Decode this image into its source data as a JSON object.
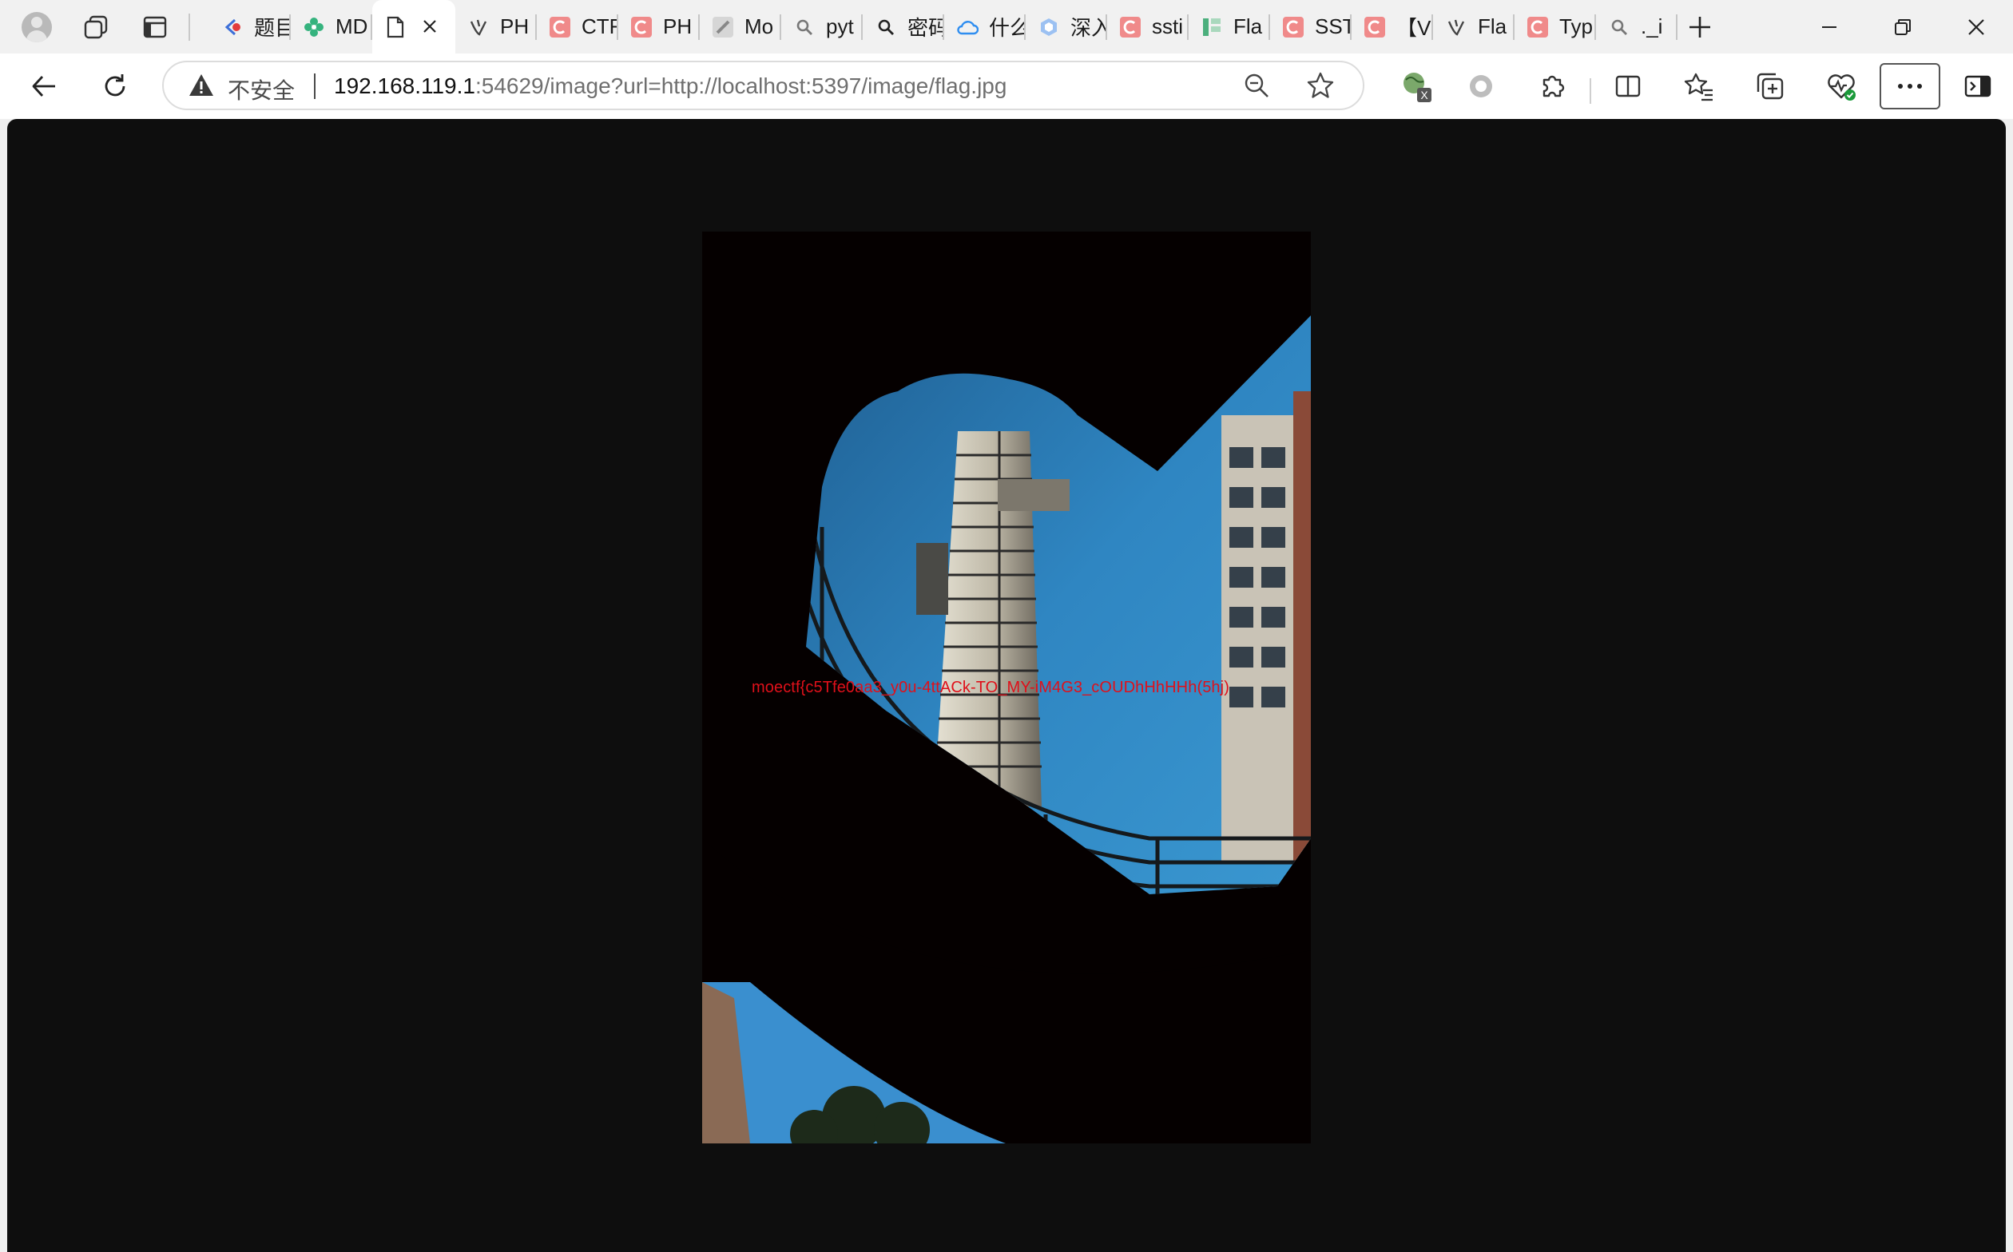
{
  "browser": {
    "tabs": [
      {
        "name": "tab-1",
        "title": "题目",
        "icon": "red-arrow-favicon",
        "color": "#e23b3b"
      },
      {
        "name": "tab-2",
        "title": "MD",
        "icon": "flower-favicon",
        "color": "#35b37e"
      },
      {
        "name": "tab-3",
        "title": "",
        "icon": "page-icon",
        "color": "#555555",
        "active": true
      },
      {
        "name": "tab-4",
        "title": "PH",
        "icon": "bird-favicon",
        "color": "#555555"
      },
      {
        "name": "tab-5",
        "title": "CTF",
        "icon": "c-favicon",
        "color": "#f08a8a"
      },
      {
        "name": "tab-6",
        "title": "PH",
        "icon": "c-favicon",
        "color": "#f08a8a"
      },
      {
        "name": "tab-7",
        "title": "Mo",
        "icon": "pen-favicon",
        "color": "#aaaaaa"
      },
      {
        "name": "tab-8",
        "title": "pyt",
        "icon": "search-favicon",
        "color": "#777777"
      },
      {
        "name": "tab-9",
        "title": "密码",
        "icon": "search-favicon",
        "color": "#222222"
      },
      {
        "name": "tab-10",
        "title": "什么",
        "icon": "cloud-favicon",
        "color": "#2f8ef0"
      },
      {
        "name": "tab-11",
        "title": "深入",
        "icon": "hex-favicon",
        "color": "#7aa6e6"
      },
      {
        "name": "tab-12",
        "title": "ssti",
        "icon": "c-favicon",
        "color": "#f08a8a"
      },
      {
        "name": "tab-13",
        "title": "Fla",
        "icon": "bars-favicon",
        "color": "#4caf7d"
      },
      {
        "name": "tab-14",
        "title": "SST",
        "icon": "c-favicon",
        "color": "#f08a8a"
      },
      {
        "name": "tab-15",
        "title": "【V",
        "icon": "c-favicon",
        "color": "#f08a8a"
      },
      {
        "name": "tab-16",
        "title": "Fla",
        "icon": "bird-favicon",
        "color": "#555555"
      },
      {
        "name": "tab-17",
        "title": "Typ",
        "icon": "c-favicon",
        "color": "#f08a8a"
      },
      {
        "name": "tab-18",
        "title": "._i",
        "icon": "search-favicon",
        "color": "#777777"
      }
    ],
    "address_bar": {
      "security_label": "不安全",
      "url_host": "192.168.119.1",
      "url_rest": ":54629/image?url=http://localhost:5397/image/flag.jpg"
    }
  },
  "page": {
    "image_overlay_text": "moectf{c5Tfe0aa3_y0u-4ttACk-TO_MY-iM4G3_cOUDhHhHHh(5hj)"
  },
  "colors": {
    "viewport_bg": "#0e0e0e",
    "flag_text": "#e0101a",
    "sky": "#2f86c2"
  }
}
